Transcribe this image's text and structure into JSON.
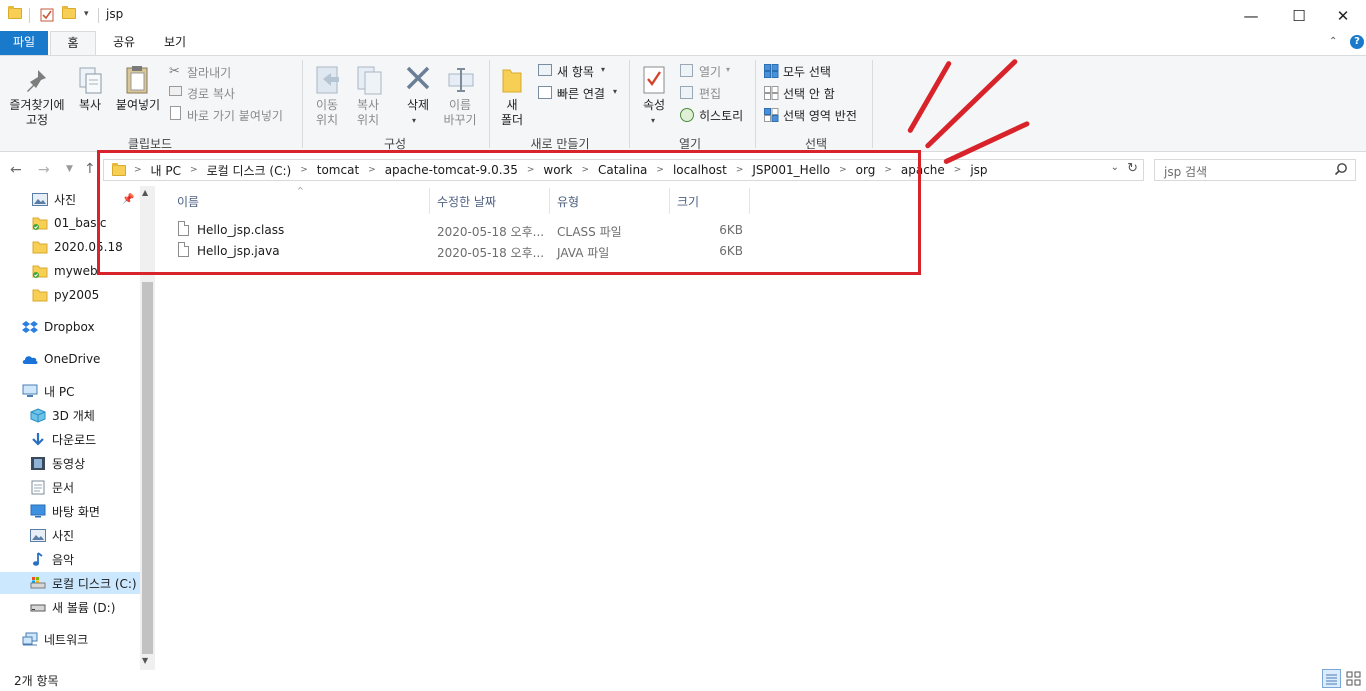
{
  "window": {
    "title": "jsp",
    "minimize": "—",
    "maximize": "☐",
    "close": "✕"
  },
  "ribbon_tabs": [
    "파일",
    "홈",
    "공유",
    "보기"
  ],
  "ribbon": {
    "clipboard": {
      "pin": "즐겨찾기에\n고정",
      "copy": "복사",
      "paste": "붙여넣기",
      "cut": "잘라내기",
      "copy_path": "경로 복사",
      "paste_shortcut": "바로 가기 붙여넣기",
      "label": "클립보드"
    },
    "organize": {
      "move_to": "이동\n위치",
      "copy_to": "복사\n위치",
      "delete": "삭제",
      "rename": "이름\n바꾸기",
      "label": "구성"
    },
    "new": {
      "new_folder": "새\n폴더",
      "new_item": "새 항목",
      "easy_access": "빠른 연결",
      "label": "새로 만들기"
    },
    "open": {
      "properties": "속성",
      "open": "열기",
      "edit": "편집",
      "history": "히스토리",
      "label": "열기"
    },
    "select": {
      "select_all": "모두 선택",
      "select_none": "선택 안 함",
      "invert": "선택 영역 반전",
      "label": "선택"
    }
  },
  "address": {
    "crumbs": [
      "내 PC",
      "로컬 디스크 (C:)",
      "tomcat",
      "apache-tomcat-9.0.35",
      "work",
      "Catalina",
      "localhost",
      "JSP001_Hello",
      "org",
      "apache",
      "jsp"
    ]
  },
  "search": {
    "placeholder": "jsp 검색"
  },
  "sidebar": {
    "items": [
      {
        "label": "사진",
        "icon": "pictures-icon"
      },
      {
        "label": "01_basic",
        "icon": "folder-icon"
      },
      {
        "label": "2020.05.18",
        "icon": "folder-icon"
      },
      {
        "label": "myweb",
        "icon": "folder-icon"
      },
      {
        "label": "py2005",
        "icon": "folder-icon"
      },
      {
        "label": "Dropbox",
        "icon": "dropbox-icon"
      },
      {
        "label": "OneDrive",
        "icon": "onedrive-icon"
      },
      {
        "label": "내 PC",
        "icon": "pc-icon"
      },
      {
        "label": "3D 개체",
        "icon": "3d-objects-icon"
      },
      {
        "label": "다운로드",
        "icon": "download-icon"
      },
      {
        "label": "동영상",
        "icon": "video-icon"
      },
      {
        "label": "문서",
        "icon": "documents-icon"
      },
      {
        "label": "바탕 화면",
        "icon": "desktop-icon"
      },
      {
        "label": "사진",
        "icon": "pictures-icon"
      },
      {
        "label": "음악",
        "icon": "music-icon"
      },
      {
        "label": "로컬 디스크 (C:)",
        "icon": "drive-c-icon"
      },
      {
        "label": "새 볼륨 (D:)",
        "icon": "drive-d-icon"
      },
      {
        "label": "네트워크",
        "icon": "network-icon"
      }
    ]
  },
  "file_list": {
    "columns": [
      "이름",
      "수정한 날짜",
      "유형",
      "크기"
    ],
    "rows": [
      {
        "name": "Hello_jsp.class",
        "date": "2020-05-18 오후...",
        "type": "CLASS 파일",
        "size": "6KB"
      },
      {
        "name": "Hello_jsp.java",
        "date": "2020-05-18 오후...",
        "type": "JAVA 파일",
        "size": "6KB"
      }
    ]
  },
  "status": {
    "count": "2개 항목"
  },
  "colors": {
    "accent": "#1979ca",
    "annotation": "#d8232a",
    "selection": "#cce8ff"
  }
}
